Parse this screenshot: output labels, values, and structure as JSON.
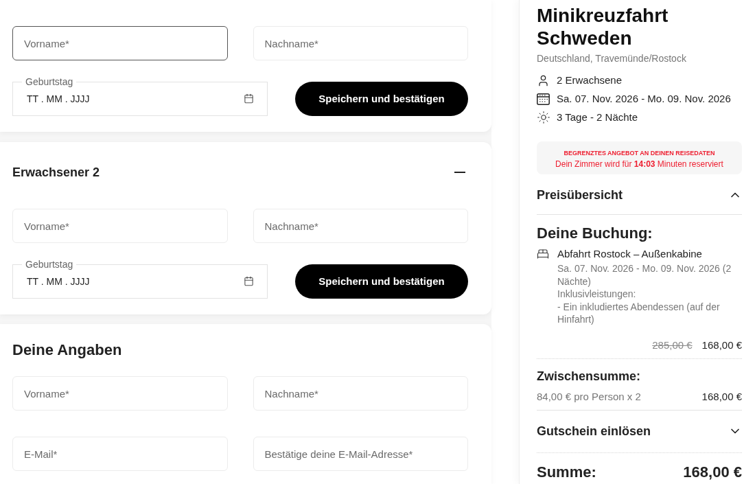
{
  "traveler_forms": [
    {
      "fields": [
        {
          "placeholder": "Vorname*",
          "focused": true
        },
        {
          "placeholder": "Nachname*",
          "focused": false
        }
      ],
      "birthday": {
        "label": "Geburtstag",
        "placeholder": "TT . MM . JJJJ"
      },
      "button": "Speichern und bestätigen"
    },
    {
      "heading": "Erwachsener 2",
      "expanded": true,
      "fields": [
        {
          "placeholder": "Vorname*",
          "focused": false
        },
        {
          "placeholder": "Nachname*",
          "focused": false
        }
      ],
      "birthday": {
        "label": "Geburtstag",
        "placeholder": "TT . MM . JJJJ"
      },
      "button": "Speichern und bestätigen"
    }
  ],
  "personal_details": {
    "heading": "Deine Angaben",
    "fields": [
      {
        "placeholder": "Vorname*",
        "focused": false
      },
      {
        "placeholder": "Nachname*",
        "focused": false
      },
      {
        "placeholder": "E-Mail*",
        "focused": false
      },
      {
        "placeholder": "Bestätige deine E-Mail-Adresse*",
        "focused": false
      }
    ]
  },
  "trip_summary": {
    "title": "Minikreuzfahrt Schweden",
    "location": "Deutschland, Travemünde/Rostock",
    "facts": [
      {
        "kind": "travelers",
        "text": "2 Erwachsene"
      },
      {
        "kind": "dates",
        "text": "Sa. 07. Nov. 2026 - Mo. 09. Nov. 2026"
      },
      {
        "kind": "duration",
        "text": "3 Tage - 2 Nächte"
      }
    ],
    "offer_notice": {
      "title": "BEGRENZTES ANGEBOT AN DEINEN REISEDATEN",
      "text": "Dein Zimmer wird für **14:03** Minuten reserviert"
    },
    "price_overview": {
      "title": "Preisübersicht",
      "expanded": true,
      "booking_heading": "Deine Buchung:",
      "items": [
        {
          "name": "Abfahrt Rostock – Außenkabine",
          "dates": "Sa. 07. Nov. 2026 - Mo. 09. Nov. 2026 (2 Nächte)",
          "inclusions_label": "Inklusivleistungen:",
          "inclusions": [
            "- Ein inkludiertes Abendessen (auf der Hinfahrt)"
          ],
          "old_price": "285,00 €",
          "price": "168,00 €"
        }
      ],
      "subtotal": {
        "label": "Zwischensumme:",
        "detail": "84,00 € pro Person x 2",
        "amount": "168,00 €"
      }
    },
    "voucher": {
      "label": "Gutschein einlösen",
      "expanded": false
    },
    "total": {
      "label": "Summe:",
      "amount": "168,00 €"
    }
  }
}
